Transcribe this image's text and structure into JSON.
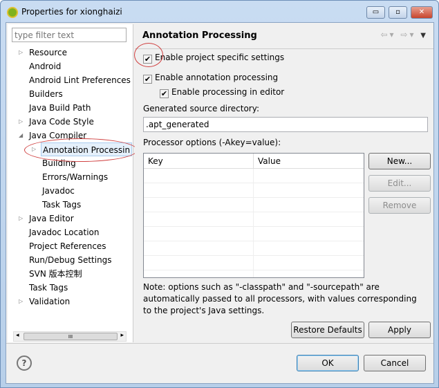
{
  "window": {
    "title": "Properties for xionghaizi",
    "minimize": "▭",
    "maximize": "▫",
    "close": "✕"
  },
  "filter": {
    "placeholder": "type filter text"
  },
  "tree": [
    {
      "label": "Resource",
      "level": 0,
      "twisty": "▷"
    },
    {
      "label": "Android",
      "level": 0,
      "twisty": ""
    },
    {
      "label": "Android Lint Preferences",
      "level": 0,
      "twisty": ""
    },
    {
      "label": "Builders",
      "level": 0,
      "twisty": ""
    },
    {
      "label": "Java Build Path",
      "level": 0,
      "twisty": ""
    },
    {
      "label": "Java Code Style",
      "level": 0,
      "twisty": "▷"
    },
    {
      "label": "Java Compiler",
      "level": 0,
      "twisty": "◢"
    },
    {
      "label": "Annotation Processin",
      "level": 1,
      "twisty": "▷",
      "selected": true
    },
    {
      "label": "Building",
      "level": 1,
      "twisty": ""
    },
    {
      "label": "Errors/Warnings",
      "level": 1,
      "twisty": ""
    },
    {
      "label": "Javadoc",
      "level": 1,
      "twisty": ""
    },
    {
      "label": "Task Tags",
      "level": 1,
      "twisty": ""
    },
    {
      "label": "Java Editor",
      "level": 0,
      "twisty": "▷"
    },
    {
      "label": "Javadoc Location",
      "level": 0,
      "twisty": ""
    },
    {
      "label": "Project References",
      "level": 0,
      "twisty": ""
    },
    {
      "label": "Run/Debug Settings",
      "level": 0,
      "twisty": ""
    },
    {
      "label": "SVN 版本控制",
      "level": 0,
      "twisty": ""
    },
    {
      "label": "Task Tags",
      "level": 0,
      "twisty": ""
    },
    {
      "label": "Validation",
      "level": 0,
      "twisty": "▷"
    }
  ],
  "scrollbar": {
    "left": "◂",
    "thumb": "III",
    "right": "▸"
  },
  "page": {
    "title": "Annotation Processing",
    "nav": {
      "back": "⇦",
      "forward": "⇨",
      "menu": "▼",
      "dropdown": "▾"
    },
    "enable_project": {
      "label": "Enable project specific settings",
      "checked": true
    },
    "enable_annotation": {
      "label": "Enable annotation processing",
      "checked": true
    },
    "enable_editor": {
      "label": "Enable processing in editor",
      "checked": true
    },
    "gen_dir_label": "Generated source directory:",
    "gen_dir_value": ".apt_generated",
    "options_label": "Processor options (-Akey=value):",
    "columns": [
      "Key",
      "Value"
    ],
    "buttons": {
      "new": "New...",
      "edit": "Edit...",
      "remove": "Remove"
    },
    "note": "Note: options such as \"-classpath\" and \"-sourcepath\" are automatically passed to all processors, with values corresponding to the project's Java settings.",
    "restore": "Restore Defaults",
    "apply": "Apply"
  },
  "footer": {
    "help": "?",
    "ok": "OK",
    "cancel": "Cancel"
  },
  "check_mark": "✔"
}
